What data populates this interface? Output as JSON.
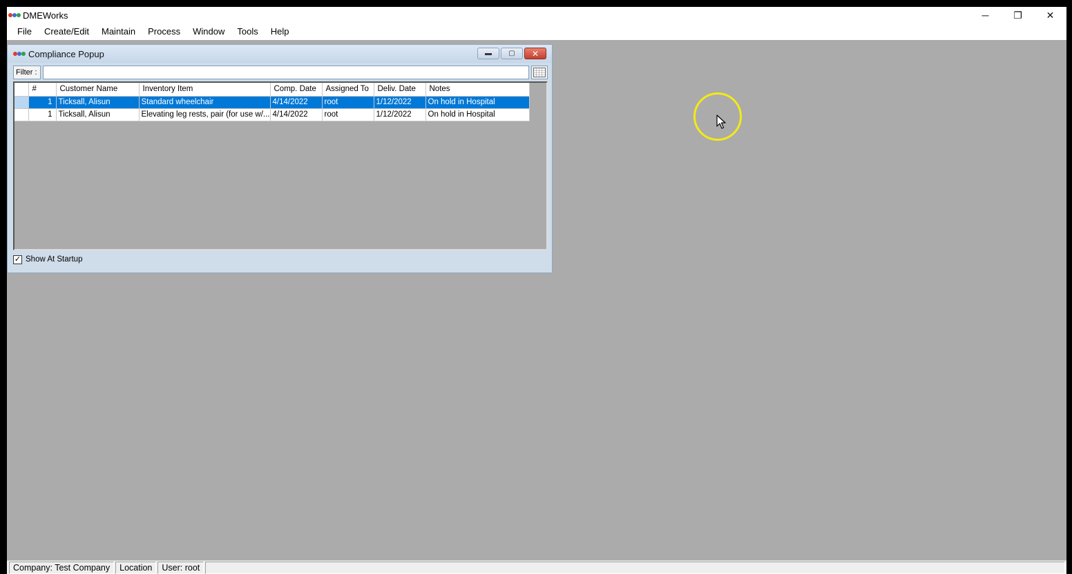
{
  "app": {
    "title": "DMEWorks",
    "logo_colors": [
      "#e03a2f",
      "#3a6ecf",
      "#2fa04a"
    ]
  },
  "window_controls": {
    "minimize": "─",
    "restore": "❐",
    "close": "✕"
  },
  "menu": [
    "File",
    "Create/Edit",
    "Maintain",
    "Process",
    "Window",
    "Tools",
    "Help"
  ],
  "child_window": {
    "title": "Compliance Popup",
    "buttons": {
      "minimize": "▬",
      "maximize": "▢",
      "close": "✕"
    }
  },
  "filter": {
    "label": "Filter :",
    "value": "",
    "placeholder": ""
  },
  "grid": {
    "columns": [
      "#",
      "Customer Name",
      "Inventory Item",
      "Comp. Date",
      "Assigned To",
      "Deliv. Date",
      "Notes"
    ],
    "rows": [
      {
        "num": "1",
        "customer": "Ticksall, Alisun",
        "item": "Standard wheelchair",
        "comp_date": "4/14/2022",
        "assigned": "root",
        "deliv_date": "1/12/2022",
        "notes": "On hold in Hospital",
        "selected": true
      },
      {
        "num": "1",
        "customer": "Ticksall, Alisun",
        "item": "Elevating leg rests, pair (for use w/...",
        "comp_date": "4/14/2022",
        "assigned": "root",
        "deliv_date": "1/12/2022",
        "notes": "On hold in Hospital",
        "selected": false
      }
    ]
  },
  "startup": {
    "label": "Show At Startup",
    "checked": true
  },
  "status": {
    "company": "Company: Test Company",
    "location": "Location",
    "user": "User: root"
  },
  "colors": {
    "selection": "#0078d7",
    "mdi_background": "#ababab",
    "cursor_ring": "#f2ea17"
  }
}
